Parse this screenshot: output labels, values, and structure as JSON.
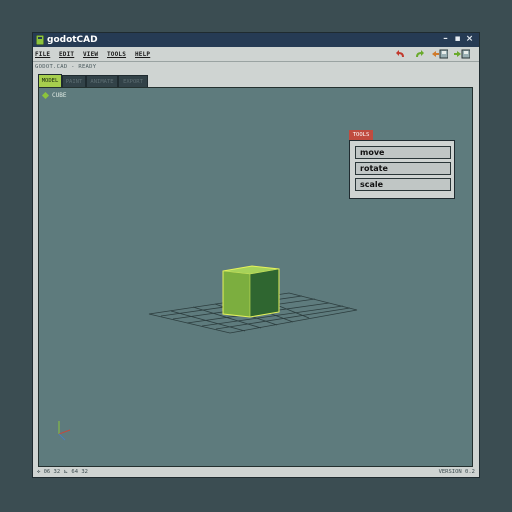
{
  "app": {
    "title": "godotCAD",
    "status": "GODOT.CAD - READY",
    "version": "VERSION 0.2",
    "coords": "✣ 06 32  ⊾ 64 32"
  },
  "menu": [
    "FILE",
    "EDIT",
    "VIEW",
    "TOOLS",
    "HELP"
  ],
  "tabs": [
    "MODEL",
    "PAINT",
    "ANIMATE",
    "EXPORT"
  ],
  "active_tab": "MODEL",
  "scene": {
    "selected_object": "CUBE"
  },
  "tools": {
    "title": "TOOLS",
    "buttons": [
      "move",
      "rotate",
      "scale"
    ]
  },
  "colors": {
    "titlebar": "#263b54",
    "viewport": "#5e7b7d",
    "accent_green": "#a7cf4e",
    "tools_tab_red": "#c04b3f"
  },
  "icons": [
    "app-icon",
    "minimize-icon",
    "maximize-icon",
    "close-icon",
    "undo-icon",
    "redo-icon",
    "open-file-icon",
    "save-file-icon"
  ]
}
